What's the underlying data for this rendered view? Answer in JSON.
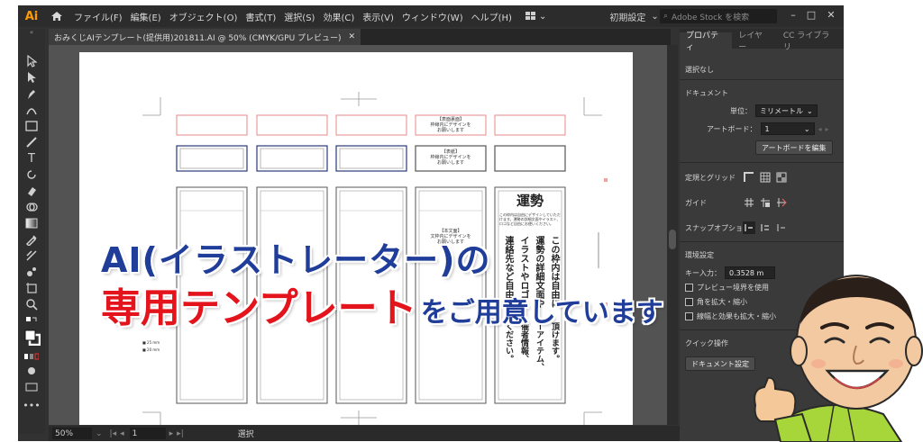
{
  "app": {
    "logo": "Ai",
    "menu": [
      "ファイル(F)",
      "編集(E)",
      "オブジェクト(O)",
      "書式(T)",
      "選択(S)",
      "効果(C)",
      "表示(V)",
      "ウィンドウ(W)",
      "ヘルプ(H)"
    ],
    "workspace": "初期設定",
    "stock_search_placeholder": "Adobe Stock を検索",
    "document_tab": "おみくじAIテンプレート(提供用)201811.AI @ 50% (CMYK/GPU プレビュー)"
  },
  "panel": {
    "tabs": [
      "プロパティ",
      "レイヤー",
      "CC ライブラリ"
    ],
    "no_selection": "選択なし",
    "document_heading": "ドキュメント",
    "unit_label": "単位：",
    "unit_value": "ミリメートル",
    "artboard_label": "アートボード：",
    "artboard_value": "1",
    "edit_artboard_button": "アートボードを編集",
    "rulers_grid": "定規とグリッド",
    "guides": "ガイド",
    "snap_options": "スナップオプション",
    "preferences_heading": "環境設定",
    "key_increment_label": "キー入力：",
    "key_increment_value": "0.3528 m",
    "preview_bounds": "プレビュー境界を使用",
    "scale_corners": "角を拡大・縮小",
    "scale_strokes": "線幅と効果も拡大・縮小",
    "quick_actions": "クイック操作",
    "document_setup_button": "ドキュメント設定"
  },
  "status": {
    "zoom": "50%",
    "page": "1",
    "mode": "選択"
  },
  "artboard_content": {
    "label_front": "【表面裏面】\n枠線内にデザインを\nお願いします",
    "label_front2": "【表紙】\n枠線内にデザインを\nお願いします",
    "label_body": "【本文面】\n文枠内にデザインを\nお願いします",
    "fortune_title": "運勢",
    "fortune_note": "この枠内は自由にデザインしていただけます。運勢の詳細文面やイラスト、ロゴなど自由にお使いください。",
    "fortune_columns": [
      "この枠内は自由に",
      "運勢の詳細文面や",
      "イラストやロゴ",
      "連絡先など自由に"
    ],
    "fortune_columns2": [
      "頂けます。",
      "ーアイテム、",
      "催者情報、",
      "ください。"
    ],
    "small_caption1": "■ 25 mm",
    "small_caption2": "■ 20 mm"
  },
  "overlay": {
    "line1": "AI(イラストレーター)の",
    "line2_red": "専用テンプレート",
    "line2_blue": "をご用意しています"
  },
  "colors": {
    "accent_ai": "#ff9a00",
    "headline_blue": "#1f3d99",
    "headline_red": "#e4141c",
    "template_red": "#e58a8a",
    "template_blue": "#2a3a7a"
  }
}
